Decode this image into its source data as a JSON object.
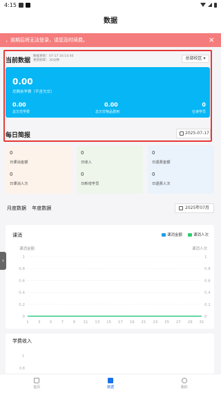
{
  "status_bar": {
    "time": "4:15"
  },
  "header": {
    "title": "数据"
  },
  "notice": {
    "text": "，逾期后将无法登录，请您及时续费。",
    "close_glyph": "×"
  },
  "current": {
    "title": "当前数据",
    "update_time": "数据更新：07-17 16:14:46",
    "update_freq": "更新频率：30分钟",
    "campus": "总部校区"
  },
  "summary": {
    "total_value": "0.00",
    "total_label": "总剩余学费（不含欠交）",
    "items": [
      {
        "value": "0.00",
        "label": "总欠交学费"
      },
      {
        "value": "0.00",
        "label": "总欠交物品费用"
      },
      {
        "value": "0",
        "label": "在读学员"
      }
    ]
  },
  "daily": {
    "title": "每日简报",
    "date": "2025-07-17",
    "cells": [
      {
        "value": "0",
        "label": "日课消金额",
        "value2": "0",
        "label2": "日课消人次",
        "bg": "#fdf3ea"
      },
      {
        "value": "0",
        "label": "日收入",
        "value2": "0",
        "label2": "日新增学员",
        "bg": "#eef6ec"
      },
      {
        "value": "0",
        "label": "日退费金额",
        "value2": "0",
        "label2": "日退费人次",
        "bg": "#eaf2fb"
      }
    ]
  },
  "stats_tabs": {
    "monthly": "月度数据",
    "yearly": "年度数据",
    "month": "2025年07月"
  },
  "consumption_chart": {
    "title": "课消",
    "legend": [
      {
        "name": "课消金额",
        "color": "#1e9fe8"
      },
      {
        "name": "课消人次",
        "color": "#2ecc71"
      }
    ]
  },
  "chart_data": [
    {
      "type": "line",
      "title": "课消",
      "ylabel_left": "课消金额",
      "ylabel_right": "课消人次",
      "ylim": [
        0,
        1
      ],
      "yticks": [
        "1",
        "0.8",
        "0.6",
        "0.4",
        "0.2",
        "0"
      ],
      "x": [
        1,
        3,
        5,
        7,
        9,
        11,
        13,
        15,
        17,
        19,
        21,
        23,
        25,
        27,
        29,
        31
      ],
      "series": [
        {
          "name": "课消金额",
          "color": "#1e9fe8",
          "values": [
            0,
            0,
            0,
            0,
            0,
            0,
            0,
            0,
            0,
            0,
            0,
            0,
            0,
            0,
            0,
            0
          ]
        },
        {
          "name": "课消人次",
          "color": "#2ecc71",
          "values": [
            0,
            0,
            0,
            0,
            0,
            0,
            0,
            0,
            0,
            0,
            0,
            0,
            0,
            0,
            0,
            0
          ]
        }
      ],
      "grid": true,
      "legend_position": "top-right"
    }
  ],
  "income_chart": {
    "title": "学费收入",
    "ticks": [
      "1",
      "0.8"
    ]
  },
  "tabbar": {
    "items": [
      {
        "label": "首页"
      },
      {
        "label": "数据"
      },
      {
        "label": "我的"
      }
    ]
  }
}
